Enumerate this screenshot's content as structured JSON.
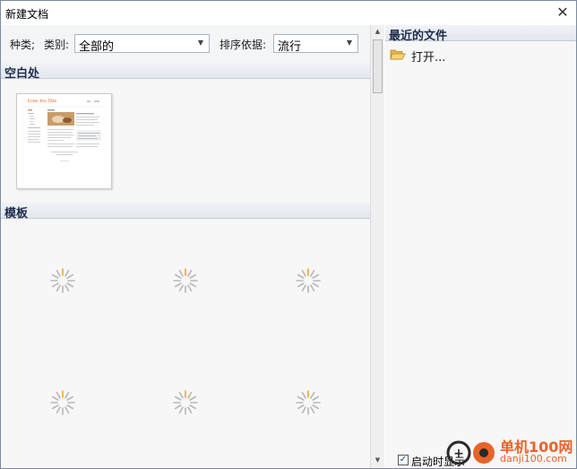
{
  "window": {
    "title": "新建文档",
    "close_glyph": "✕"
  },
  "filters": {
    "kind_label": "种类;",
    "category_label": "类别:",
    "category_value": "全部的",
    "sort_label": "排序依据:",
    "sort_value": "流行"
  },
  "sections": {
    "blank": "空白处",
    "templates": "模板",
    "recent": "最近的文件"
  },
  "blank_template": {
    "heading": "Enter the Title"
  },
  "recent": {
    "open_label": "打开..."
  },
  "startup": {
    "checked": true,
    "label": "启动时显示"
  },
  "watermark": {
    "brand": "单机100网",
    "url": "danji100.com"
  },
  "colors": {
    "accent_spinner": "#f5a623",
    "header_text": "#1e2c4a",
    "brand": "#e8632a"
  },
  "icons": [
    "close-icon",
    "chevron-down-icon",
    "folder-open-icon",
    "loading-spinner-icon"
  ]
}
